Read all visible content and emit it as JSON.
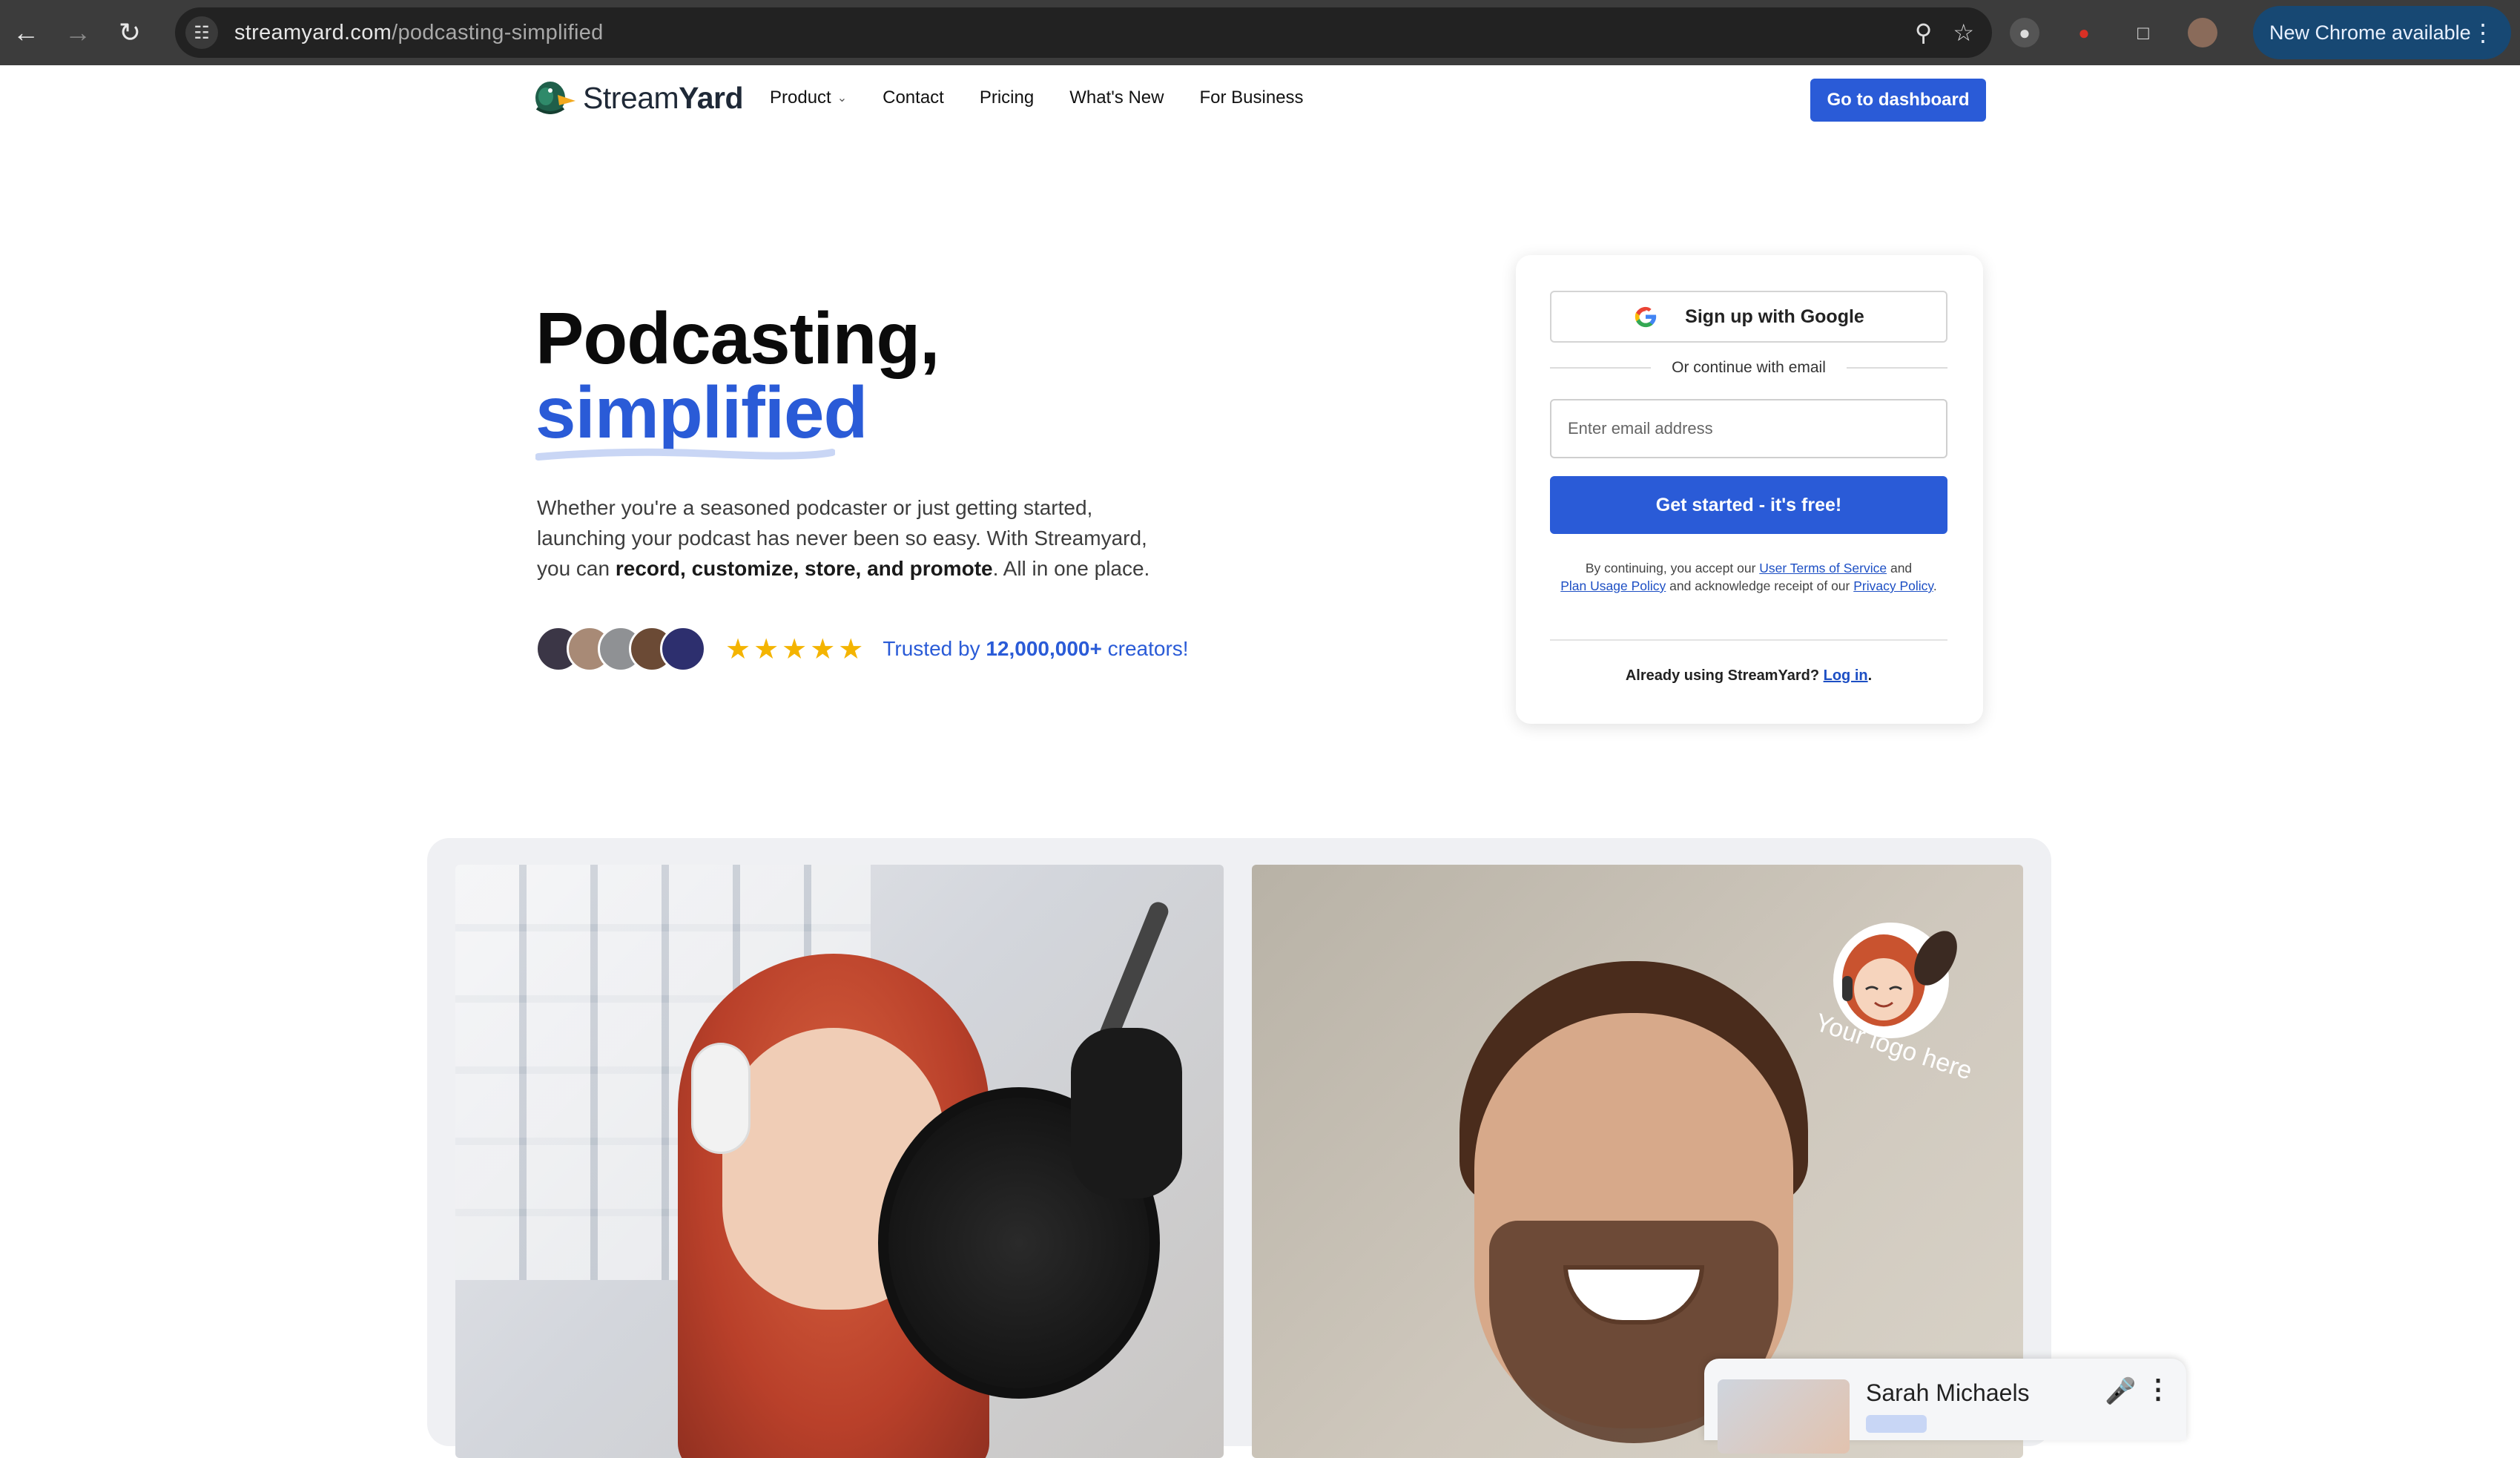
{
  "browser": {
    "url_domain": "streamyard.com",
    "url_path": "/podcasting-simplified",
    "update_button": "New Chrome available"
  },
  "header": {
    "logo_text_light": "Stream",
    "logo_text_bold": "Yard",
    "nav": [
      {
        "label": "Product"
      },
      {
        "label": "Contact"
      },
      {
        "label": "Pricing"
      },
      {
        "label": "What's New"
      },
      {
        "label": "For Business"
      }
    ],
    "dashboard_button": "Go to dashboard"
  },
  "hero": {
    "title_line1": "Podcasting,",
    "title_line2": "simplified",
    "desc_line1": "Whether you're a seasoned podcaster or just getting started,",
    "desc_line2": "launching your podcast has never been so easy. With Streamyard,",
    "desc_line3_pre": "you can ",
    "desc_line3_bold": "record, customize, store, and promote",
    "desc_line3_post": ". All in one place.",
    "rating": 5,
    "trust_pre": "Trusted by ",
    "trust_count": "12,000,000+",
    "trust_post": " creators!"
  },
  "signup": {
    "google_button": "Sign up with Google",
    "divider_text": "Or continue with email",
    "email_placeholder": "Enter email address",
    "cta": "Get started - it's free!",
    "legal_pre": "By continuing, you accept our ",
    "legal_terms": "User Terms of Service",
    "legal_and": " and",
    "legal_policy": "Plan Usage Policy",
    "legal_mid": " and acknowledge receipt of our ",
    "legal_privacy": "Privacy Policy",
    "legal_end": ".",
    "already": "Already using StreamYard? ",
    "login_link": "Log in",
    "login_end": "."
  },
  "preview": {
    "logo_badge_text": "Your logo here",
    "participant_name": "Sarah Michaels"
  },
  "colors": {
    "brand_blue": "#2a5bd7",
    "star_gold": "#f4b400",
    "chrome_bar": "#3c3c3c"
  }
}
